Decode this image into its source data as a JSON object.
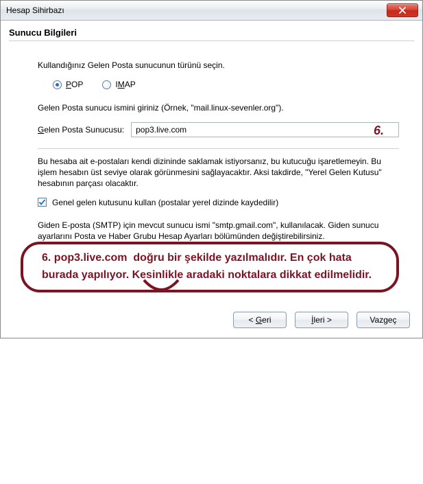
{
  "window": {
    "title": "Hesap Sihirbazı"
  },
  "section": {
    "title": "Sunucu Bilgileri"
  },
  "instruction": "Kullandığınız Gelen Posta sunucunun türünü seçin.",
  "protocol": {
    "pop": {
      "prefix": "P",
      "rest": "OP",
      "selected": true
    },
    "imap": {
      "prefix": "I",
      "underline": "M",
      "rest": "AP",
      "selected": false
    }
  },
  "server_example": "Gelen Posta sunucu ismini giriniz (Örnek, \"mail.linux-sevenler.org\").",
  "server_field": {
    "label_prefix": "G",
    "label_rest": "elen Posta Sunucusu:",
    "value": "pop3.live.com"
  },
  "step_badge": "6.",
  "storage_note": "Bu hesaba ait e-postaları kendi dizininde saklamak istiyorsanız, bu kutucuğu işaretlemeyin. Bu işlem hesabın üst seviye olarak görünmesini sağlayacaktır. Aksi takdirde, \"Yerel Gelen Kutusu\" hesabının parçası olacaktır.",
  "global_inbox": {
    "checked": true,
    "label": "Genel gelen kutusunu kullan (postalar yerel dizinde kaydedilir)"
  },
  "smtp_note": "Giden E-posta (SMTP) için mevcut sunucu ismi \"smtp.gmail.com\", kullanılacak. Giden sunucu ayarlarını Posta ve Haber Grubu Hesap Ayarları bölümünden değiştirebilirsiniz.",
  "annotation": {
    "line1_prefix": "6.",
    "line1_host": "pop3.live.com",
    "line1_rest": "doğru bir şekilde yazılmalıdır. En çok hata",
    "line2": "burada yapılıyor. Kesinlikle aradaki noktalara dikkat edilmelidir."
  },
  "buttons": {
    "back_prefix": "< ",
    "back_ul": "G",
    "back_rest": "eri",
    "next_ul": "İ",
    "next_rest": "leri >",
    "cancel": "Vazgeç"
  }
}
